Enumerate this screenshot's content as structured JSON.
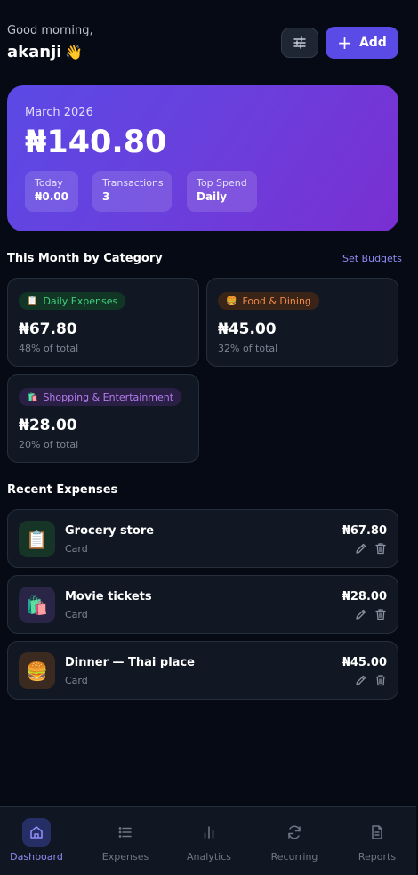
{
  "header": {
    "greeting": "Good morning,",
    "username": "akanji",
    "wave_emoji": "👋",
    "add_label": "Add",
    "filter_icon": "sliders-icon"
  },
  "summary": {
    "period": "March 2026",
    "total": "₦140.80",
    "stats": [
      {
        "label": "Today",
        "value": "₦0.00"
      },
      {
        "label": "Transactions",
        "value": "3"
      },
      {
        "label": "Top Spend",
        "value": "Daily"
      }
    ]
  },
  "categories": {
    "title": "This Month by Category",
    "action": "Set Budgets",
    "items": [
      {
        "name": "Daily Expenses",
        "icon": "📋",
        "amount": "₦67.80",
        "share": "48% of total",
        "color": "#3fcf7a",
        "bg": "#123626"
      },
      {
        "name": "Food & Dining",
        "icon": "🍔",
        "amount": "₦45.00",
        "share": "32% of total",
        "color": "#f0894a",
        "bg": "#3a2418"
      },
      {
        "name": "Shopping & Entertainment",
        "icon": "🛍️",
        "amount": "₦28.00",
        "share": "20% of total",
        "color": "#b57bf0",
        "bg": "#2a1f44"
      }
    ]
  },
  "recent": {
    "title": "Recent Expenses",
    "items": [
      {
        "name": "Grocery store",
        "method": "Card",
        "amount": "₦67.80",
        "icon": "📋",
        "icon_bg": "#163526"
      },
      {
        "name": "Movie tickets",
        "method": "Card",
        "amount": "₦28.00",
        "icon": "🛍️",
        "icon_bg": "#2a2446"
      },
      {
        "name": "Dinner — Thai place",
        "method": "Card",
        "amount": "₦45.00",
        "icon": "🍔",
        "icon_bg": "#3a2a20"
      }
    ]
  },
  "tabs": [
    {
      "label": "Dashboard",
      "icon": "home-icon",
      "active": true
    },
    {
      "label": "Expenses",
      "icon": "list-icon",
      "active": false
    },
    {
      "label": "Analytics",
      "icon": "bar-chart-icon",
      "active": false
    },
    {
      "label": "Recurring",
      "icon": "refresh-icon",
      "active": false
    },
    {
      "label": "Reports",
      "icon": "document-icon",
      "active": false
    }
  ],
  "colors": {
    "accent": "#5a4be6",
    "background": "#060a14",
    "card": "#121823",
    "link": "#8f8cf5"
  }
}
